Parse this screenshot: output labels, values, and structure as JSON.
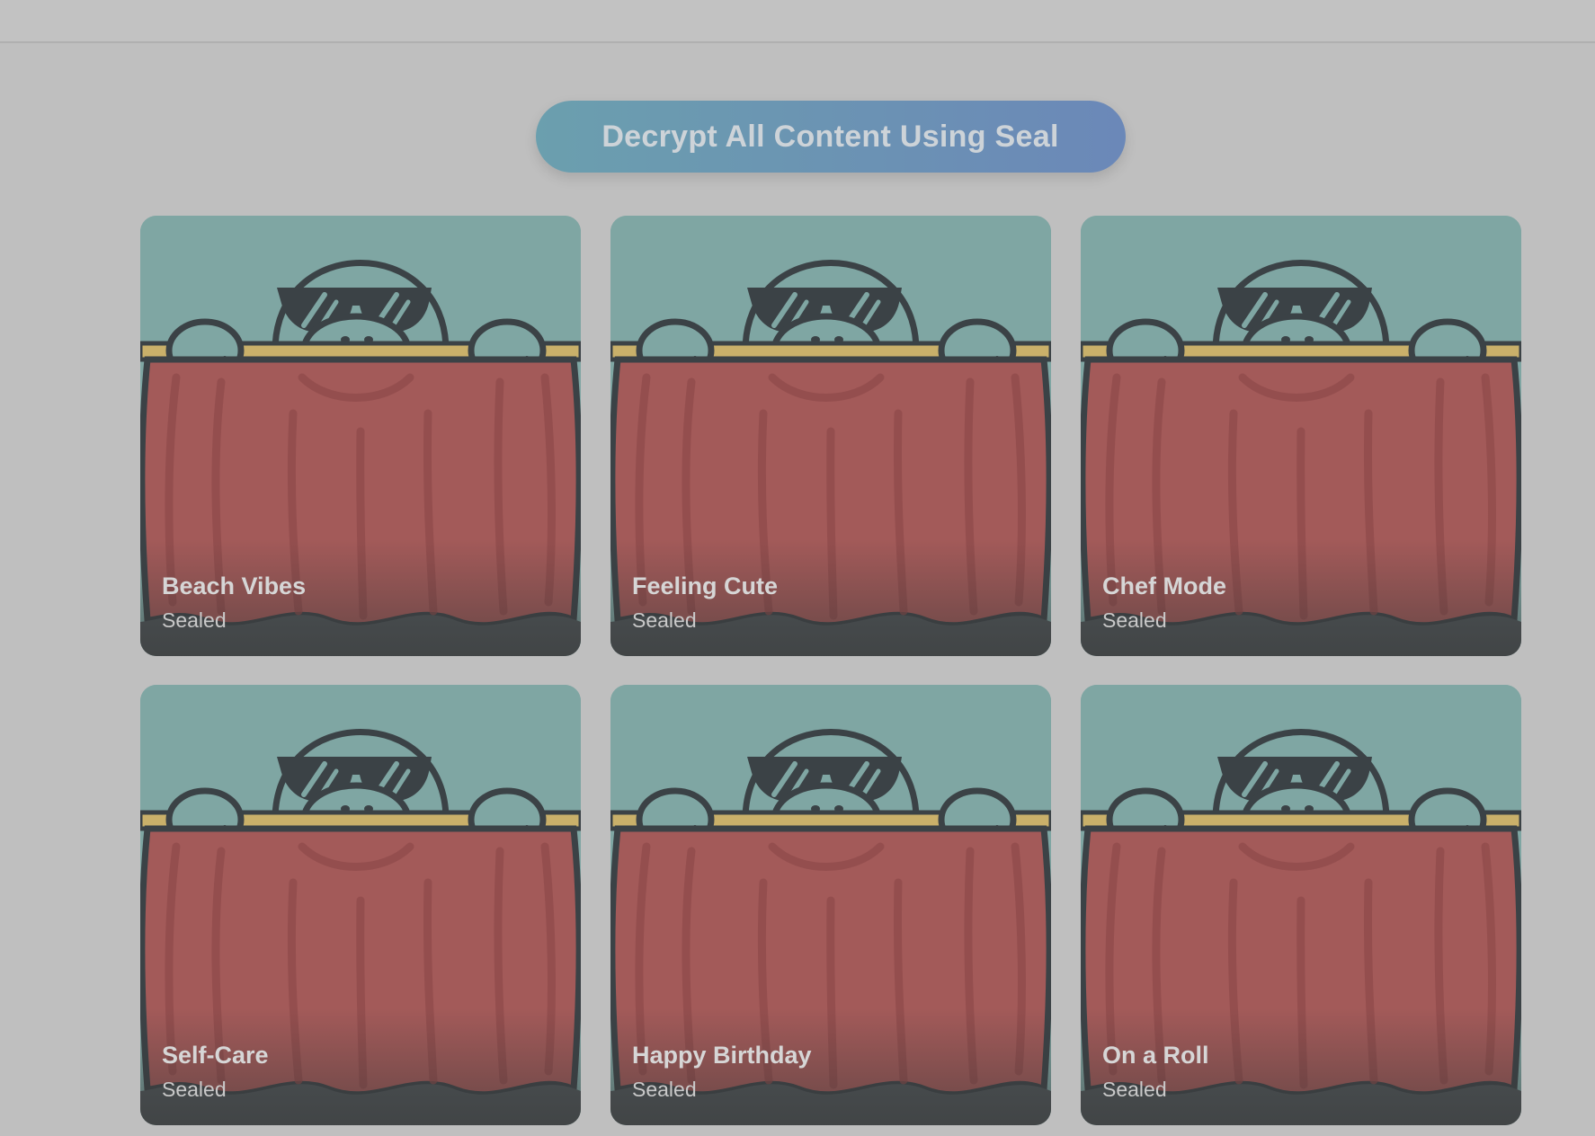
{
  "actions": {
    "decrypt_label": "Decrypt All Content Using Seal"
  },
  "cards": [
    {
      "title": "Beach Vibes",
      "status": "Sealed"
    },
    {
      "title": "Feeling Cute",
      "status": "Sealed"
    },
    {
      "title": "Chef Mode",
      "status": "Sealed"
    },
    {
      "title": "Self-Care",
      "status": "Sealed"
    },
    {
      "title": "Happy Birthday",
      "status": "Sealed"
    },
    {
      "title": "On a Roll",
      "status": "Sealed"
    }
  ],
  "colors": {
    "background": "#bfbfbf",
    "card_sky": "#7fa6a3",
    "curtain": "#a35a59",
    "curtain_rod": "#c9b06a",
    "outline": "#3b4246",
    "button_gradient_start": "#6b9fae",
    "button_gradient_end": "#6b88b8"
  },
  "icons": {
    "card_artwork": "seal-peeking-over-curtain-icon"
  }
}
